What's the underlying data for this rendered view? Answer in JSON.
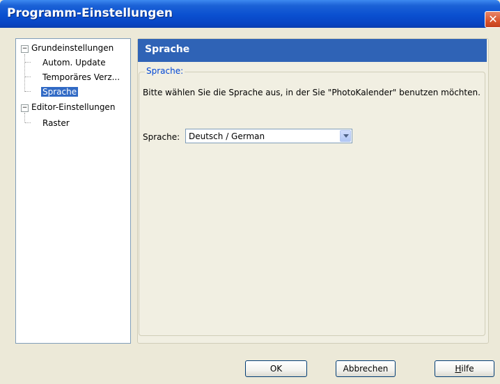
{
  "window": {
    "title": "Programm-Einstellungen",
    "close_label": "✕"
  },
  "tree": {
    "groups": [
      {
        "label": "Grundeinstellungen",
        "expander": "−",
        "children": [
          "Autom. Update",
          "Temporäres Verz...",
          "Sprache"
        ]
      },
      {
        "label": "Editor-Einstellungen",
        "expander": "−",
        "children": [
          "Raster"
        ]
      }
    ],
    "selected": "Sprache"
  },
  "panel": {
    "header": "Sprache",
    "group_title": "Sprache:",
    "description": "Bitte wählen Sie die Sprache aus, in der Sie \"PhotoKalender\" benutzen möchten.",
    "language_label": "Sprache:",
    "language_value": "Deutsch / German"
  },
  "buttons": {
    "ok": "OK",
    "cancel": "Abbrechen",
    "help_first": "H",
    "help_rest": "ilfe"
  }
}
